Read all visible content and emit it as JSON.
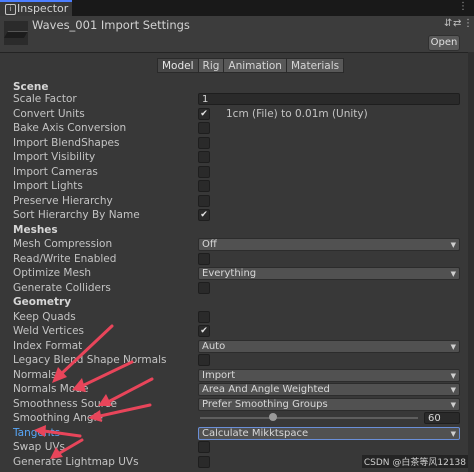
{
  "window": {
    "tab_label": "Inspector",
    "tab_icon": "info-icon",
    "tab_menu": "⋮"
  },
  "header": {
    "title": "Waves_001 Import Settings",
    "help_icon": "⇵",
    "settings_icon": "⇄",
    "menu_icon": "⋮",
    "open_label": "Open"
  },
  "tabs": [
    "Model",
    "Rig",
    "Animation",
    "Materials"
  ],
  "sections": {
    "scene": "Scene",
    "meshes": "Meshes",
    "geometry": "Geometry"
  },
  "fields": {
    "scale_factor": {
      "label": "Scale Factor",
      "value": "1"
    },
    "convert_units": {
      "label": "Convert Units",
      "checked": true,
      "note": "1cm (File) to 0.01m (Unity)"
    },
    "bake_axis_conversion": {
      "label": "Bake Axis Conversion",
      "checked": false
    },
    "import_blendshapes": {
      "label": "Import BlendShapes",
      "checked": false
    },
    "import_visibility": {
      "label": "Import Visibility",
      "checked": false
    },
    "import_cameras": {
      "label": "Import Cameras",
      "checked": false
    },
    "import_lights": {
      "label": "Import Lights",
      "checked": false
    },
    "preserve_hierarchy": {
      "label": "Preserve Hierarchy",
      "checked": false
    },
    "sort_hierarchy": {
      "label": "Sort Hierarchy By Name",
      "checked": true
    },
    "mesh_compression": {
      "label": "Mesh Compression",
      "value": "Off"
    },
    "read_write": {
      "label": "Read/Write Enabled",
      "checked": false
    },
    "optimize_mesh": {
      "label": "Optimize Mesh",
      "value": "Everything"
    },
    "generate_colliders": {
      "label": "Generate Colliders",
      "checked": false
    },
    "keep_quads": {
      "label": "Keep Quads",
      "checked": false
    },
    "weld_vertices": {
      "label": "Weld Vertices",
      "checked": true
    },
    "index_format": {
      "label": "Index Format",
      "value": "Auto"
    },
    "legacy_blend": {
      "label": "Legacy Blend Shape Normals",
      "checked": false
    },
    "normals": {
      "label": "Normals",
      "value": "Import"
    },
    "normals_mode": {
      "label": "Normals Mode",
      "value": "Area And Angle Weighted"
    },
    "smoothness_source": {
      "label": "Smoothness Source",
      "value": "Prefer Smoothing Groups"
    },
    "smoothing_angle": {
      "label": "Smoothing Angle",
      "value": "60",
      "fraction": 0.333
    },
    "tangents": {
      "label": "Tangents",
      "value": "Calculate Mikktspace"
    },
    "swap_uvs": {
      "label": "Swap UVs",
      "checked": false
    },
    "generate_lightmap_uvs": {
      "label": "Generate Lightmap UVs",
      "checked": false
    }
  },
  "watermark": "CSDN @白茶等风12138",
  "colors": {
    "accent": "#4c7eff",
    "link": "#58a6f7",
    "annotation_arrow": "#e8455a"
  }
}
